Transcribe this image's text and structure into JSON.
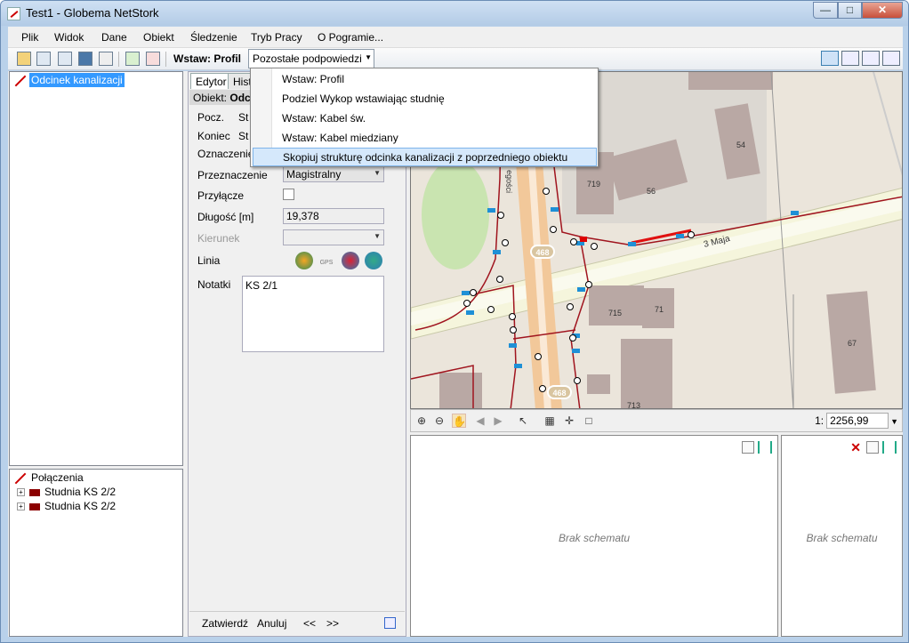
{
  "window": {
    "title": "Test1 - Globema NetStork"
  },
  "menu": [
    "Plik",
    "Widok",
    "Dane",
    "Obiekt",
    "Śledzenie",
    "Tryb Pracy",
    "O Pogramie..."
  ],
  "toolbar": {
    "wstaw_label": "Wstaw: Profil",
    "hints_label": "Pozostałe podpowiedzi"
  },
  "dropdown": {
    "items": [
      "Wstaw: Profil",
      "Podziel Wykop wstawiając studnię",
      "Wstaw: Kabel św.",
      "Wstaw: Kabel miedziany",
      "Skopiuj strukturę odcinka kanalizacji z poprzedniego obiektu"
    ]
  },
  "tree": {
    "root": "Odcinek kanalizacji"
  },
  "connections": {
    "root": "Połączenia",
    "items": [
      "Studnia KS 2/2",
      "Studnia KS 2/2"
    ]
  },
  "editor": {
    "tabs": [
      "Edytor",
      "Histo"
    ],
    "obiekt_label": "Obiekt:",
    "obiekt_value": "Odc",
    "pocz_label": "Pocz.",
    "pocz_value": "St",
    "koniec_label": "Koniec",
    "koniec_value": "St",
    "oznaczenie_label": "Oznaczenie",
    "przeznaczenie_label": "Przeznaczenie",
    "przeznaczenie_value": "Magistralny",
    "przylacze_label": "Przyłącze",
    "dlugosc_label": "Długość [m]",
    "dlugosc_value": "19,378",
    "kierunek_label": "Kierunek",
    "linia_label": "Linia",
    "gps_label": "GPS",
    "notatki_label": "Notatki",
    "notatki_value": "KS 2/1",
    "zatwierdz": "Zatwierdź",
    "anuluj": "Anuluj",
    "prev": "<<",
    "next": ">>"
  },
  "map": {
    "street_label": "3 Maja",
    "street2_label": "egości",
    "route_badges": [
      "468",
      "468"
    ],
    "buildings": [
      "719",
      "56",
      "54",
      "715",
      "71",
      "67",
      "713"
    ],
    "scale_prefix": "1:",
    "scale_value": "2256,99"
  },
  "schemes": {
    "left": "Brak schematu",
    "right": "Brak schematu"
  }
}
